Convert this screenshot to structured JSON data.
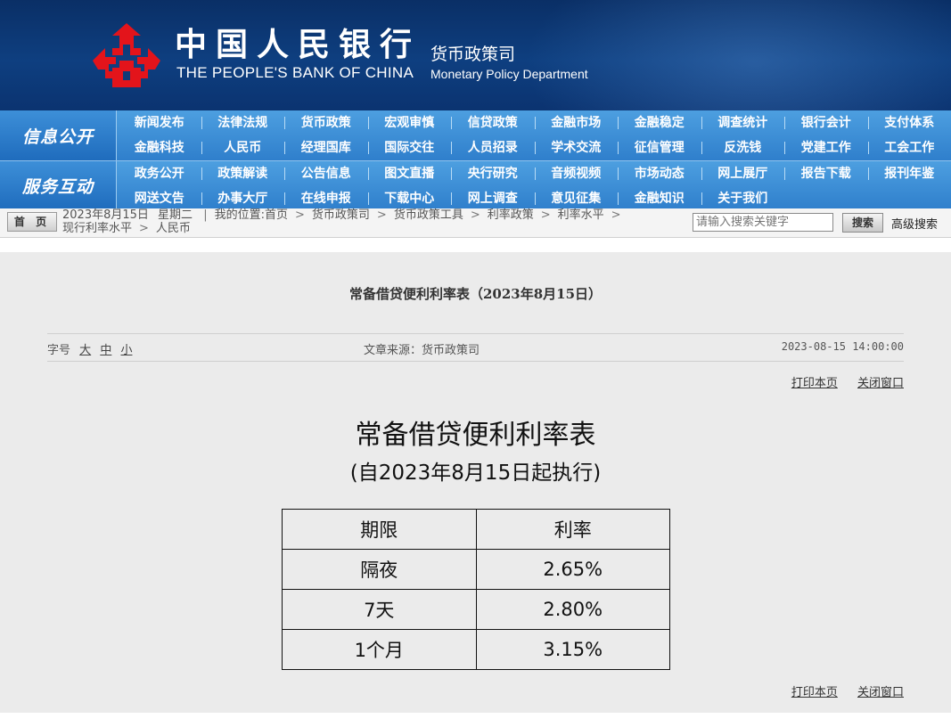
{
  "header": {
    "bank_name_cn": "中国人民银行",
    "bank_name_en": "THE PEOPLE'S BANK OF CHINA",
    "dept_cn": "货币政策司",
    "dept_en": "Monetary Policy Department",
    "emblem_icon": "pboc-emblem-icon",
    "emblem_color": "#e3141b",
    "bg_color": "#0d3a78"
  },
  "nav": {
    "section1_label": "信息公开",
    "section2_label": "服务互动",
    "row1": [
      "新闻发布",
      "法律法规",
      "货币政策",
      "宏观审慎",
      "信贷政策",
      "金融市场",
      "金融稳定",
      "调查统计",
      "银行会计",
      "支付体系"
    ],
    "row2": [
      "金融科技",
      "人民币",
      "经理国库",
      "国际交往",
      "人员招录",
      "学术交流",
      "征信管理",
      "反洗钱",
      "党建工作",
      "工会工作"
    ],
    "row3": [
      "政务公开",
      "政策解读",
      "公告信息",
      "图文直播",
      "央行研究",
      "音频视频",
      "市场动态",
      "网上展厅",
      "报告下载",
      "报刊年鉴"
    ],
    "row4": [
      "网送文告",
      "办事大厅",
      "在线申报",
      "下载中心",
      "网上调查",
      "意见征集",
      "金融知识",
      "关于我们"
    ]
  },
  "location": {
    "home_label": "首 页",
    "date": "2023年8月15日",
    "weekday": "星期二",
    "divider": "|",
    "prefix": "我的位置:首页",
    "crumbs": [
      "货币政策司",
      "货币政策工具",
      "利率政策",
      "利率水平",
      "现行利率水平",
      "人民币"
    ],
    "separator": ">"
  },
  "search": {
    "placeholder": "请输入搜索关键字",
    "button_label": "搜索",
    "advanced_label": "高级搜索"
  },
  "article": {
    "page_title": "常备借贷便利利率表（2023年8月15日）",
    "font_size_label": "字号",
    "font_sizes": [
      "大",
      "中",
      "小"
    ],
    "source": "文章来源：货币政策司",
    "datetime": "2023-08-15 14:00:00",
    "print_label": "打印本页",
    "close_label": "关闭窗口",
    "heading": "常备借贷便利利率表",
    "subheading": "(自2023年8月15日起执行)",
    "table": {
      "headers": [
        "期限",
        "利率"
      ],
      "rows": [
        [
          "隔夜",
          "2.65%"
        ],
        [
          "7天",
          "2.80%"
        ],
        [
          "1个月",
          "3.15%"
        ]
      ]
    }
  }
}
